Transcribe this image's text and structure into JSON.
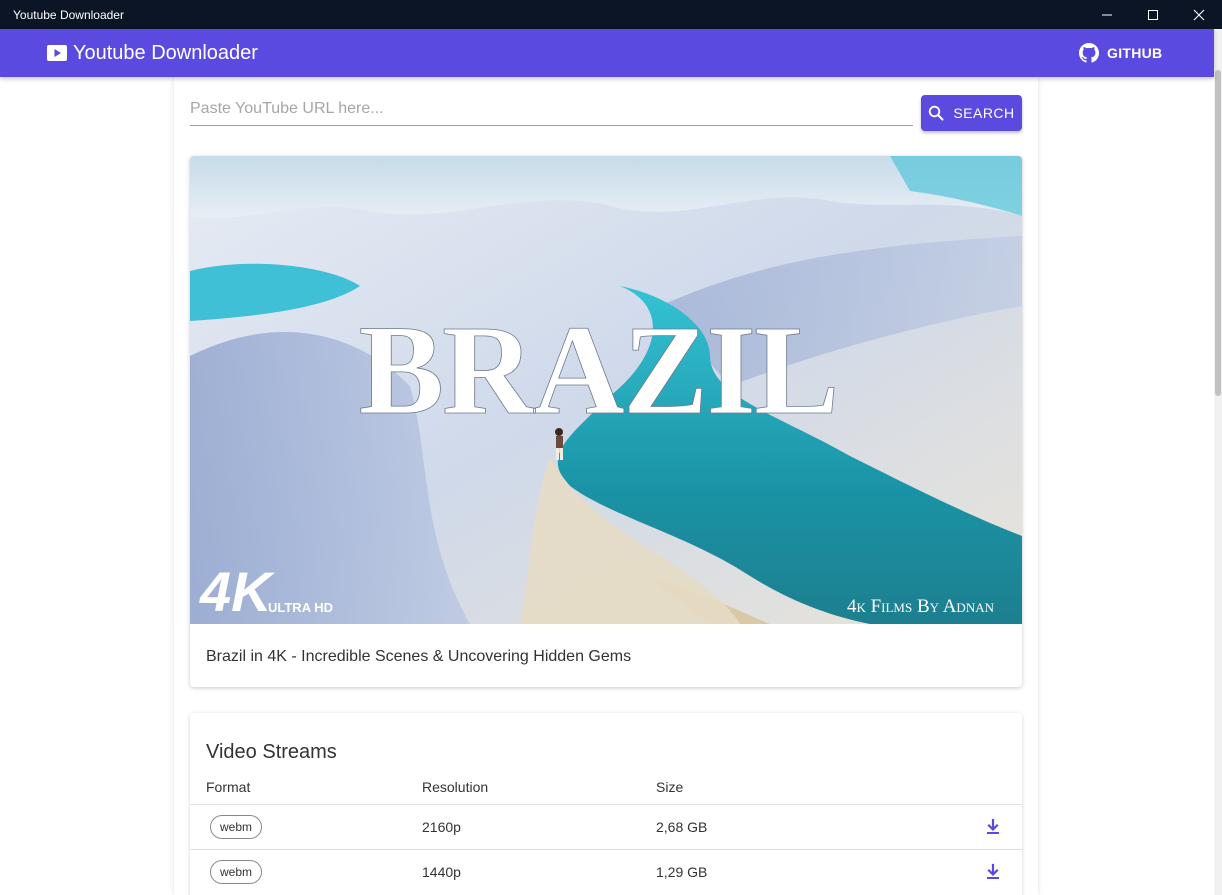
{
  "window": {
    "title": "Youtube Downloader",
    "icons": {
      "minimize": "minimize-icon",
      "maximize": "maximize-icon",
      "close": "close-icon"
    }
  },
  "appbar": {
    "title": "Youtube Downloader",
    "logo_icon": "youtube-play-icon",
    "github_label": "GITHUB",
    "github_icon": "github-icon",
    "color": "#5b4ae0"
  },
  "search": {
    "placeholder": "Paste YouTube URL here...",
    "value": "",
    "button_label": "SEARCH",
    "button_icon": "search-icon"
  },
  "video": {
    "thumbnail": {
      "title_word": "BRAZIL",
      "badge_main": "4K",
      "badge_sub": "ULTRA HD",
      "credit": "4k Films By Adnan"
    },
    "title": "Brazil in 4K - Incredible Scenes & Uncovering Hidden Gems"
  },
  "streams": {
    "heading": "Video Streams",
    "columns": [
      "Format",
      "Resolution",
      "Size"
    ],
    "rows": [
      {
        "format": "webm",
        "resolution": "2160p",
        "size": "2,68 GB",
        "action_icon": "download-icon"
      },
      {
        "format": "webm",
        "resolution": "1440p",
        "size": "1,29 GB",
        "action_icon": "download-icon"
      }
    ]
  }
}
